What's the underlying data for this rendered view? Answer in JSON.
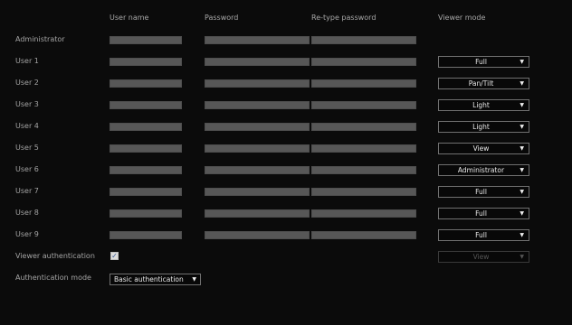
{
  "headers": {
    "user_name": "User name",
    "password": "Password",
    "retype_password": "Re-type password",
    "viewer_mode": "Viewer mode"
  },
  "users": [
    {
      "label": "Administrator",
      "viewer_mode": ""
    },
    {
      "label": "User 1",
      "viewer_mode": "Full"
    },
    {
      "label": "User 2",
      "viewer_mode": "Pan/Tilt"
    },
    {
      "label": "User 3",
      "viewer_mode": "Light"
    },
    {
      "label": "User 4",
      "viewer_mode": "Light"
    },
    {
      "label": "User 5",
      "viewer_mode": "View"
    },
    {
      "label": "User 6",
      "viewer_mode": "Administrator"
    },
    {
      "label": "User 7",
      "viewer_mode": "Full"
    },
    {
      "label": "User 8",
      "viewer_mode": "Full"
    },
    {
      "label": "User 9",
      "viewer_mode": "Full"
    }
  ],
  "viewer_authentication": {
    "label": "Viewer authentication",
    "checked": true,
    "check_glyph": "✓",
    "viewer_mode": "View",
    "viewer_mode_disabled": true
  },
  "authentication_mode": {
    "label": "Authentication mode",
    "value": "Basic authentication"
  },
  "dropdown_arrow": "▼",
  "icons": {
    "dropdown": "chevron-down-icon",
    "checkbox": "check-icon"
  }
}
